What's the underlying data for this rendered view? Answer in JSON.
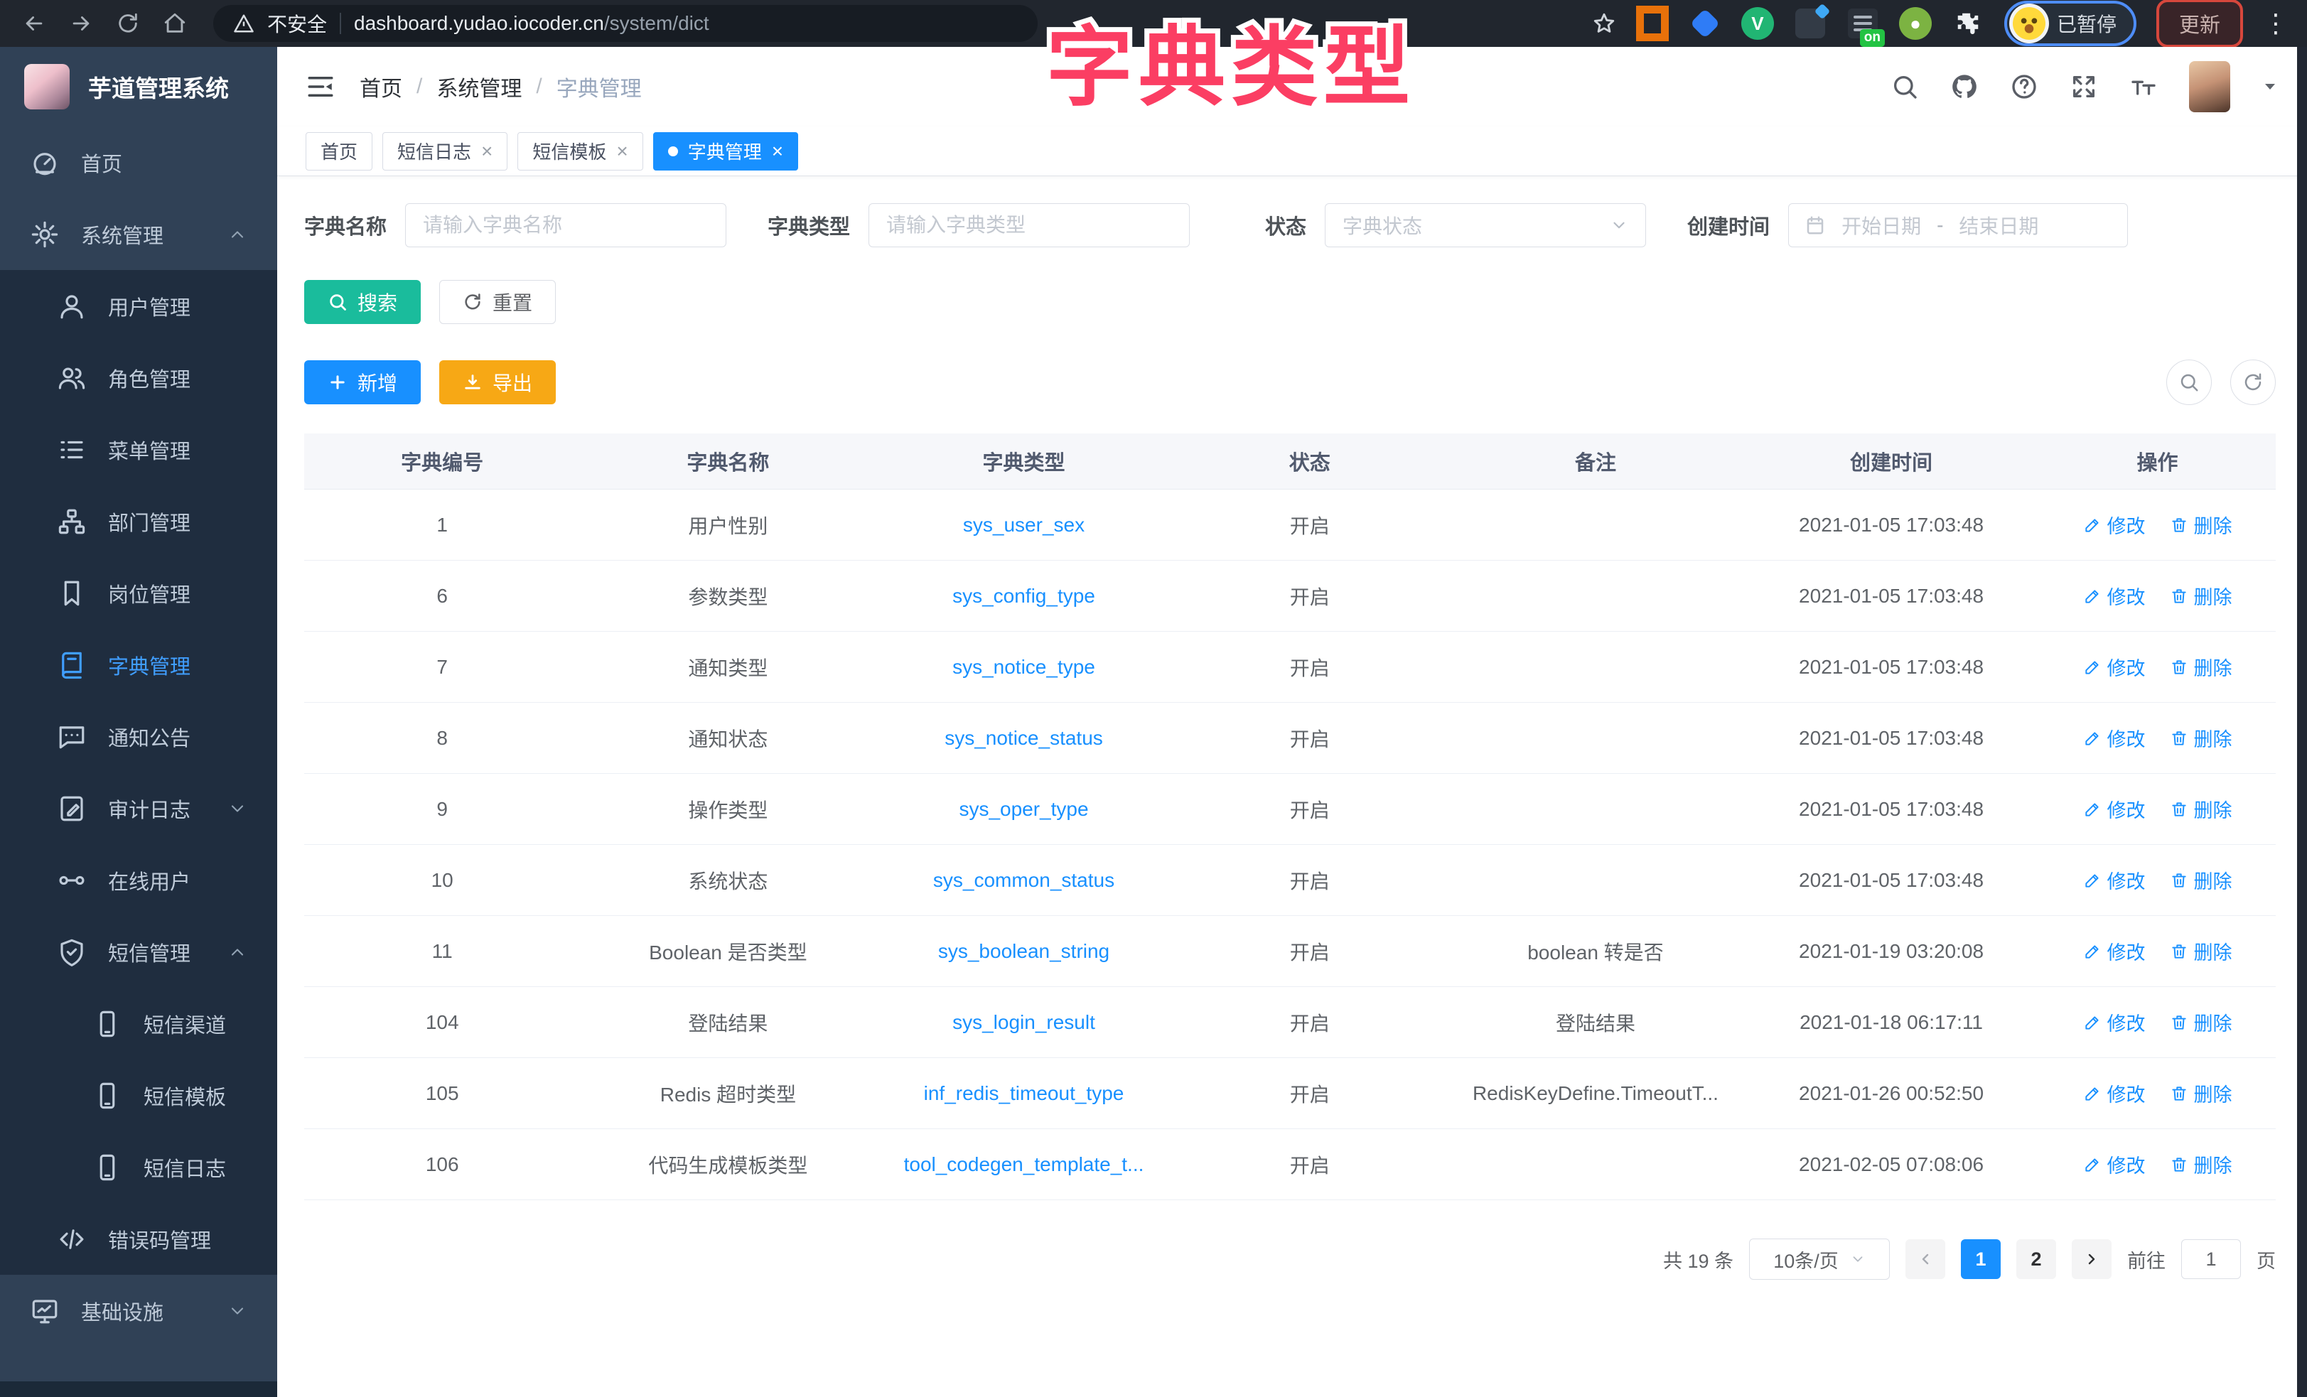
{
  "colors": {
    "accent": "#1890ff",
    "active_menu": "#409eff",
    "search_button": "#1abc9c",
    "export_button": "#f7a815",
    "overlay_pink": "#fb3e63",
    "sidebar_bg": "#304156",
    "submenu_bg": "#1f2d3f"
  },
  "overlay": {
    "text": "字典类型"
  },
  "browser": {
    "security_label": "不安全",
    "url_host": "dashboard.yudao.iocoder.cn",
    "url_path": "/system/dict",
    "extension_on_badge": "on",
    "paused_badge": "已暂停",
    "update_label": "更新"
  },
  "sidebar": {
    "app_title": "芋道管理系统",
    "items": [
      {
        "slug": "home",
        "label": "首页",
        "icon": "dashboard",
        "level": 0,
        "section": "light"
      },
      {
        "slug": "system-management",
        "label": "系统管理",
        "icon": "gear",
        "level": 0,
        "arrow": "up",
        "section": "light"
      },
      {
        "slug": "user-management",
        "label": "用户管理",
        "icon": "user",
        "level": 1
      },
      {
        "slug": "role-management",
        "label": "角色管理",
        "icon": "users",
        "level": 1
      },
      {
        "slug": "menu-management",
        "label": "菜单管理",
        "icon": "menu",
        "level": 1
      },
      {
        "slug": "dept-management",
        "label": "部门管理",
        "icon": "tree",
        "level": 1
      },
      {
        "slug": "post-management",
        "label": "岗位管理",
        "icon": "badge",
        "level": 1
      },
      {
        "slug": "dict-management",
        "label": "字典管理",
        "icon": "book",
        "level": 1,
        "active": true
      },
      {
        "slug": "notice-announcement",
        "label": "通知公告",
        "icon": "message",
        "level": 1
      },
      {
        "slug": "audit-log",
        "label": "审计日志",
        "icon": "log",
        "level": 1,
        "arrow": "down"
      },
      {
        "slug": "online-users",
        "label": "在线用户",
        "icon": "online",
        "level": 1
      },
      {
        "slug": "sms-management",
        "label": "短信管理",
        "icon": "shield",
        "level": 1,
        "arrow": "up"
      },
      {
        "slug": "sms-channel",
        "label": "短信渠道",
        "icon": "phone",
        "level": 2
      },
      {
        "slug": "sms-template",
        "label": "短信模板",
        "icon": "phone",
        "level": 2
      },
      {
        "slug": "sms-log",
        "label": "短信日志",
        "icon": "phone",
        "level": 2
      },
      {
        "slug": "error-code-management",
        "label": "错误码管理",
        "icon": "code",
        "level": 1
      },
      {
        "slug": "infrastructure",
        "label": "基础设施",
        "icon": "monitor",
        "level": 0,
        "arrow": "down",
        "section": "light"
      }
    ]
  },
  "header": {
    "breadcrumb": [
      "首页",
      "系统管理",
      "字典管理"
    ],
    "separator": "/"
  },
  "tabs": [
    {
      "slug": "home",
      "label": "首页",
      "closable": false,
      "active": false
    },
    {
      "slug": "sms-log",
      "label": "短信日志",
      "closable": true,
      "active": false
    },
    {
      "slug": "sms-template",
      "label": "短信模板",
      "closable": true,
      "active": false
    },
    {
      "slug": "dict-management",
      "label": "字典管理",
      "closable": true,
      "active": true
    }
  ],
  "filters": {
    "name_label": "字典名称",
    "name_placeholder": "请输入字典名称",
    "type_label": "字典类型",
    "type_placeholder": "请输入字典类型",
    "status_label": "状态",
    "status_placeholder": "字典状态",
    "date_label": "创建时间",
    "date_start_placeholder": "开始日期",
    "date_separator": "-",
    "date_end_placeholder": "结束日期",
    "search_label": "搜索",
    "reset_label": "重置"
  },
  "toolbar": {
    "add_label": "新增",
    "export_label": "导出"
  },
  "table": {
    "columns": [
      "字典编号",
      "字典名称",
      "字典类型",
      "状态",
      "备注",
      "创建时间",
      "操作"
    ],
    "edit_label": "修改",
    "delete_label": "删除",
    "rows": [
      {
        "id": "1",
        "name": "用户性别",
        "type": "sys_user_sex",
        "status": "开启",
        "remark": "",
        "created": "2021-01-05 17:03:48"
      },
      {
        "id": "6",
        "name": "参数类型",
        "type": "sys_config_type",
        "status": "开启",
        "remark": "",
        "created": "2021-01-05 17:03:48"
      },
      {
        "id": "7",
        "name": "通知类型",
        "type": "sys_notice_type",
        "status": "开启",
        "remark": "",
        "created": "2021-01-05 17:03:48"
      },
      {
        "id": "8",
        "name": "通知状态",
        "type": "sys_notice_status",
        "status": "开启",
        "remark": "",
        "created": "2021-01-05 17:03:48"
      },
      {
        "id": "9",
        "name": "操作类型",
        "type": "sys_oper_type",
        "status": "开启",
        "remark": "",
        "created": "2021-01-05 17:03:48"
      },
      {
        "id": "10",
        "name": "系统状态",
        "type": "sys_common_status",
        "status": "开启",
        "remark": "",
        "created": "2021-01-05 17:03:48"
      },
      {
        "id": "11",
        "name": "Boolean 是否类型",
        "type": "sys_boolean_string",
        "status": "开启",
        "remark": "boolean 转是否",
        "created": "2021-01-19 03:20:08"
      },
      {
        "id": "104",
        "name": "登陆结果",
        "type": "sys_login_result",
        "status": "开启",
        "remark": "登陆结果",
        "created": "2021-01-18 06:17:11"
      },
      {
        "id": "105",
        "name": "Redis 超时类型",
        "type": "inf_redis_timeout_type",
        "status": "开启",
        "remark": "RedisKeyDefine.TimeoutT...",
        "created": "2021-01-26 00:52:50"
      },
      {
        "id": "106",
        "name": "代码生成模板类型",
        "type": "tool_codegen_template_t...",
        "status": "开启",
        "remark": "",
        "created": "2021-02-05 07:08:06"
      }
    ]
  },
  "pagination": {
    "total_text": "共 19 条",
    "page_size": "10条/页",
    "pages": [
      "1",
      "2"
    ],
    "active_page": "1",
    "goto_label": "前往",
    "goto_value": "1",
    "page_unit": "页"
  }
}
